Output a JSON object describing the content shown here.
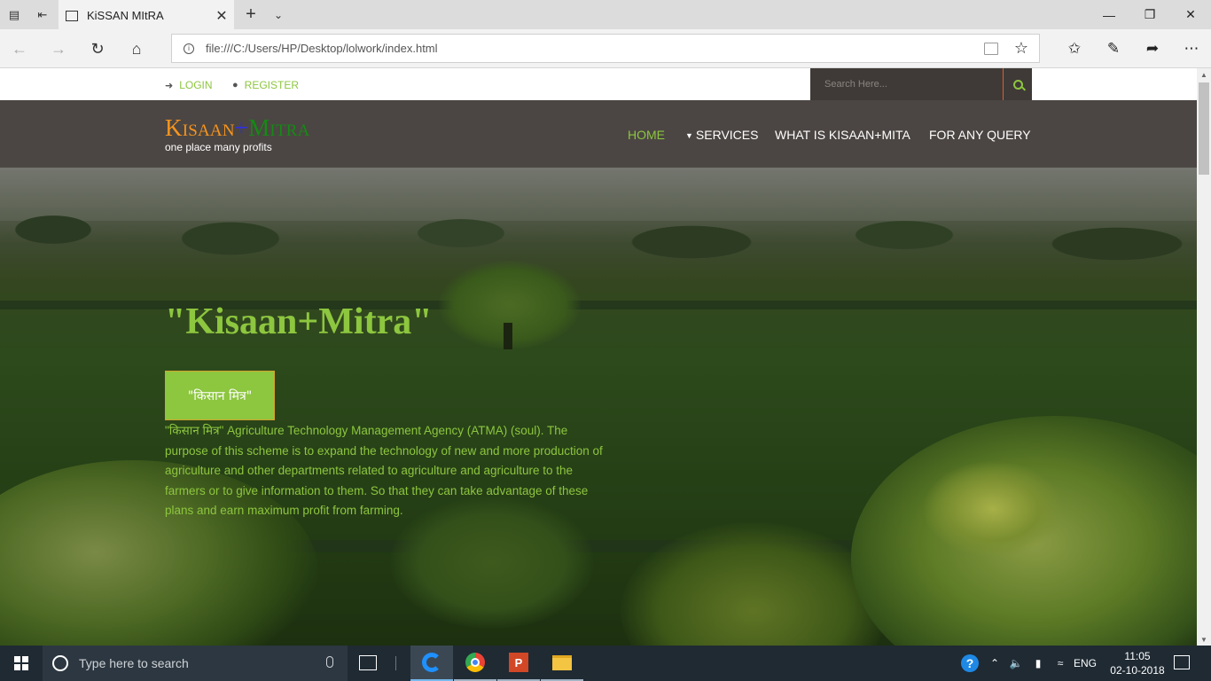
{
  "browser": {
    "tab_title": "KiSSAN MItRA",
    "url": "file:///C:/Users/HP/Desktop/lolwork/index.html"
  },
  "site": {
    "top_links": {
      "login": "LOGIN",
      "register": "REGISTER"
    },
    "search": {
      "placeholder": "Search Here..."
    },
    "logo": {
      "part1": "Kisaan",
      "plus": "+",
      "part2": "Mitra",
      "tagline": "one place many profits"
    },
    "menu": [
      {
        "label": "HOME",
        "active": true
      },
      {
        "label": "SERVICES",
        "has_dropdown": true
      },
      {
        "label": "WHAT IS KISAAN+MITA"
      },
      {
        "label": "FOR ANY QUERY"
      }
    ],
    "hero": {
      "title": "\"Kisaan+Mitra\"",
      "button_label": "\"किसान मित्र\"",
      "description": "\"किसान मित्र\" Agriculture Technology Management Agency (ATMA) (soul). The purpose of this scheme is to expand the technology of new and more production of agriculture and other departments related to agriculture and agriculture to the farmers or to give information to them. So that they can take advantage of these plans and earn maximum profit from farming."
    },
    "colors": {
      "accent": "#8dc63f",
      "header_bg": "#4b4643",
      "logo_orange": "#f7941d",
      "logo_green": "#158a15",
      "logo_plus": "#2c2cff"
    }
  },
  "taskbar": {
    "search_placeholder": "Type here to search",
    "language": "ENG",
    "time": "11:05",
    "date": "02-10-2018"
  }
}
